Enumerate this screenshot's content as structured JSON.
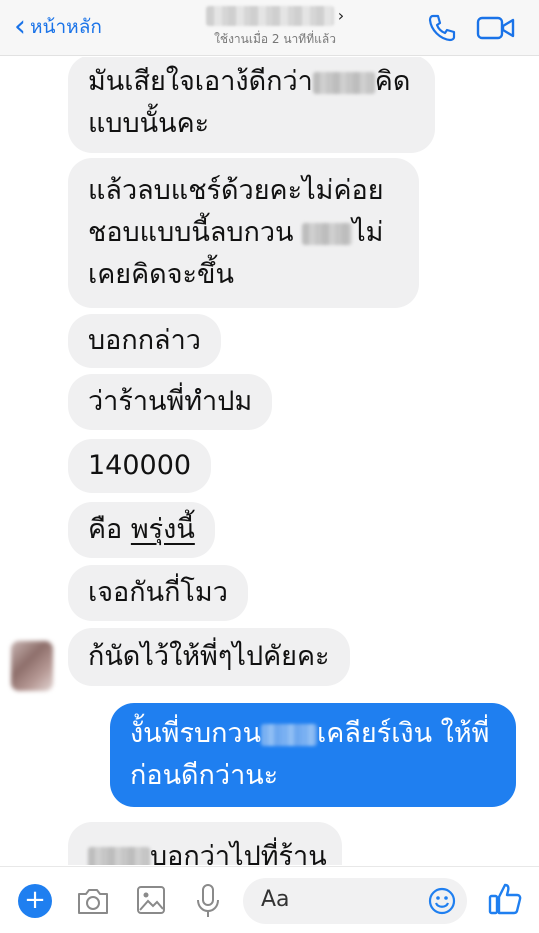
{
  "header": {
    "back_label": "หน้าหลัก",
    "subtitle": "ใช้งานเมื่อ 2 นาทีที่แล้ว",
    "icons": {
      "back": "chevron-left-icon",
      "call": "phone-icon",
      "video": "video-camera-icon"
    },
    "accent_color": "#1a73e8"
  },
  "messages": [
    {
      "from": "them",
      "lines": [
        {
          "before": "มันเสียใจเอาง้ดีกว่า",
          "after": "คิด"
        },
        {
          "before": "แบบนั้นคะ"
        }
      ]
    },
    {
      "from": "them",
      "lines": [
        {
          "before": "แล้วลบแชร์ด้วยคะไม่ค่อย"
        },
        {
          "before": "ชอบแบบนี้ลบกวน ",
          "after": "ไม่"
        },
        {
          "before": "เคยคิดจะขึ้น"
        }
      ]
    },
    {
      "from": "them",
      "text": "บอกกล่าว"
    },
    {
      "from": "them",
      "text": "ว่าร้านพี่ทำปม"
    },
    {
      "from": "them",
      "text": "140000"
    },
    {
      "from": "them",
      "prefix": "คือ ",
      "underlined": "พรุ่งนี้"
    },
    {
      "from": "them",
      "text": "เจอกันกี่โมว"
    },
    {
      "from": "them",
      "text": "ก้นัดไว้ให้พี่ๆไปคัยคะ"
    },
    {
      "from": "me",
      "lines": [
        {
          "before": "งั้นพี่รบกวน",
          "after": "เคลียร์เงิน ให้พี่"
        },
        {
          "before": "ก่อนดีกว่านะ"
        }
      ]
    },
    {
      "from": "them",
      "after": "บอกว่าไปที่ร้าน"
    }
  ],
  "composer": {
    "placeholder": "Aa",
    "icons": {
      "add": "plus-icon",
      "camera": "camera-icon",
      "gallery": "image-icon",
      "mic": "microphone-icon",
      "emoji": "smiley-icon",
      "like": "thumbs-up-icon"
    }
  },
  "colors": {
    "outgoing_bubble": "#1f7ff0",
    "incoming_bubble": "#f0f0f1"
  }
}
